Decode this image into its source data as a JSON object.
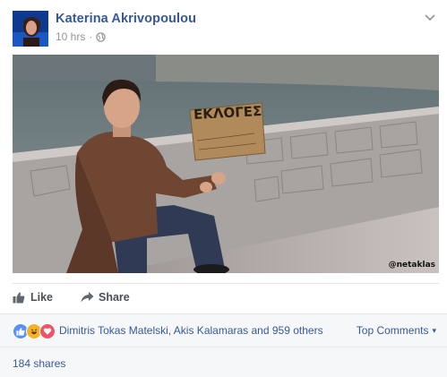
{
  "post": {
    "author": "Katerina Akrivopoulou",
    "time": "10 hrs",
    "time_separator": "·"
  },
  "photo": {
    "sign_text": "ΕΚΛΟΓΕΣ",
    "watermark": "@netaklas"
  },
  "actions": {
    "like_label": "Like",
    "share_label": "Share"
  },
  "reactions": {
    "names_text": "Dimitris Tokas Matelski, Akis Kalamaras and 959 others",
    "sort_label": "Top Comments",
    "sort_arrow": "▾"
  },
  "shares": {
    "label": "184 shares"
  },
  "colors": {
    "link": "#365899",
    "like_reaction": "#5890ff",
    "haha_reaction": "#f7b125",
    "love_reaction": "#f25268"
  }
}
